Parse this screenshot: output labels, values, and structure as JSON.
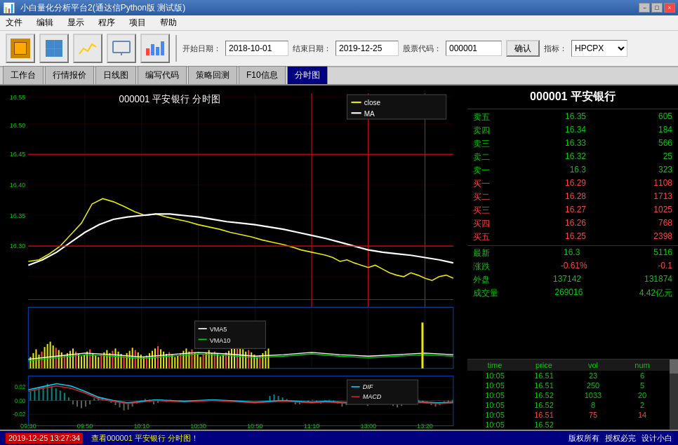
{
  "titleBar": {
    "title": "小白量化分析平台2(通达信Python版 测试版)",
    "minBtn": "－",
    "maxBtn": "□",
    "closeBtn": "×"
  },
  "menuBar": {
    "items": [
      "文件",
      "编辑",
      "显示",
      "程序",
      "项目",
      "帮助"
    ]
  },
  "toolbar": {
    "startDateLabel": "开始日期：",
    "startDate": "2018-10-01",
    "endDateLabel": "结束日期：",
    "endDate": "2019-12-25",
    "stockCodeLabel": "股票代码：",
    "stockCode": "000001",
    "confirmLabel": "确认",
    "indicatorLabel": "指标：",
    "indicator": "HPCPX"
  },
  "tabs": {
    "items": [
      "工作台",
      "行情报价",
      "日线图",
      "编写代码",
      "策略回测",
      "F10信息",
      "分时图"
    ],
    "activeIndex": 6
  },
  "stockInfo": {
    "header": "000001 平安银行",
    "orderBook": [
      {
        "label": "卖五",
        "price": "16.35",
        "vol": "605"
      },
      {
        "label": "卖四",
        "price": "16.34",
        "vol": "184"
      },
      {
        "label": "卖三",
        "price": "16.33",
        "vol": "566"
      },
      {
        "label": "卖二",
        "price": "16.32",
        "vol": "25"
      },
      {
        "label": "卖一",
        "price": "16.3",
        "vol": "323"
      },
      {
        "label": "买一",
        "price": "16.29",
        "vol": "1108"
      },
      {
        "label": "买二",
        "price": "16.28",
        "vol": "1713"
      },
      {
        "label": "买三",
        "price": "16.27",
        "vol": "1025"
      },
      {
        "label": "买四",
        "price": "16.26",
        "vol": "768"
      },
      {
        "label": "买五",
        "price": "16.25",
        "vol": "2398"
      }
    ],
    "latest": {
      "label": "最新",
      "price": "16.3",
      "vol": "5116"
    },
    "change": {
      "label": "涨跌",
      "pct": "-0.61%",
      "val": "-0.1"
    },
    "outerVol": {
      "label": "外盘",
      "val1": "137142",
      "val2": "131874"
    },
    "tradeVol": {
      "label": "成交量",
      "val1": "269016",
      "val2": "4.42亿元"
    }
  },
  "tradeTable": {
    "headers": [
      "time",
      "price",
      "vol",
      "num"
    ],
    "rows": [
      {
        "time": "10:05",
        "price": "16.51",
        "vol": "23",
        "num": "6",
        "color": "green"
      },
      {
        "time": "10:05",
        "price": "16.51",
        "vol": "250",
        "num": "5",
        "color": "green"
      },
      {
        "time": "10:05",
        "price": "16.52",
        "vol": "1033",
        "num": "20",
        "color": "green"
      },
      {
        "time": "10:05",
        "price": "16.52",
        "vol": "8",
        "num": "2",
        "color": "green"
      },
      {
        "time": "10:05",
        "price": "16.51",
        "vol": "75",
        "num": "14",
        "color": "red"
      },
      {
        "time": "10:05",
        "price": "16.52",
        "vol": "",
        "num": "",
        "color": "green"
      }
    ]
  },
  "statusBar": {
    "datetime": "2019-12-25  13:27:34",
    "message": "查看000001 平安银行 分时图！",
    "copyright": "版权所有",
    "auth": "授权必完",
    "design": "设计小白"
  },
  "chart": {
    "title": "000001 平安银行  分时图",
    "yAxisLabels": [
      "16.55",
      "16.50",
      "16.45",
      "16.40",
      "16.35",
      "16.30"
    ],
    "macdYLabels": [
      "0.02",
      "0.00",
      "-0.02"
    ],
    "xAxisLabels": [
      "09:30",
      "09:50",
      "10:10",
      "10:30",
      "10:50",
      "11:10",
      "13:00",
      "13:20"
    ],
    "legends": {
      "main": [
        {
          "label": "close",
          "color": "#e8e800"
        },
        {
          "label": "MA",
          "color": "white"
        }
      ],
      "volume": [
        {
          "label": "VMA5",
          "color": "white"
        },
        {
          "label": "VMA10",
          "color": "#00cc00"
        }
      ],
      "macd": [
        {
          "label": "DIF",
          "color": "#00ccff"
        },
        {
          "label": "MACD",
          "color": "#cc2222"
        }
      ]
    }
  }
}
